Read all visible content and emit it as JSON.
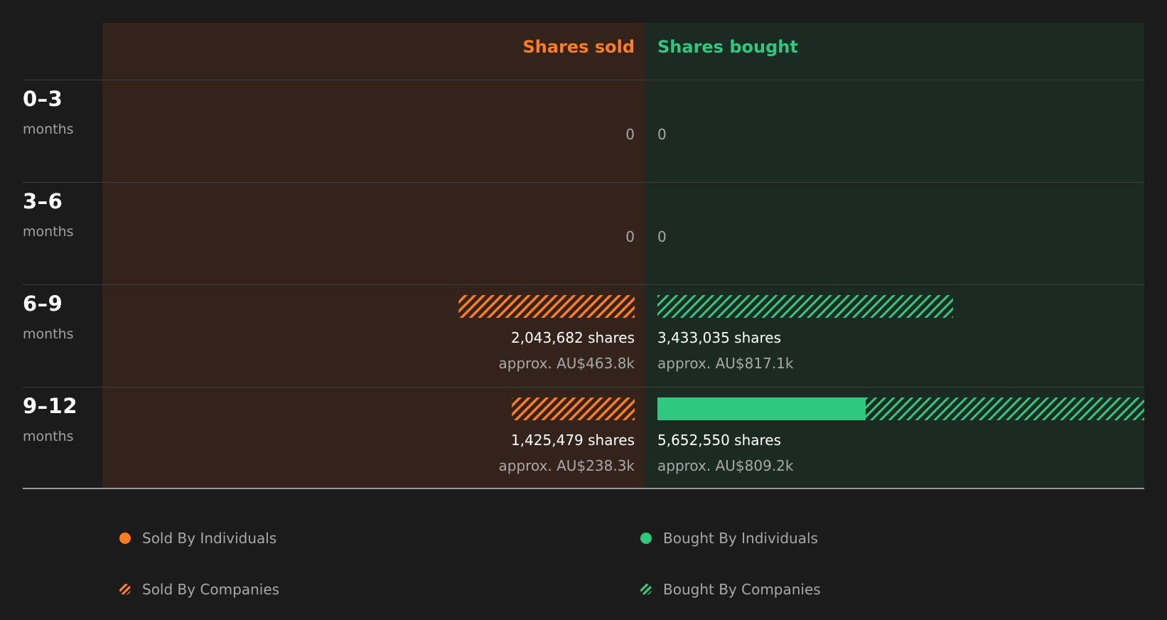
{
  "chart_data": {
    "type": "bar",
    "title": "",
    "column_headers": {
      "sold": "Shares sold",
      "bought": "Shares bought"
    },
    "colors": {
      "sold": "#ff7d1f",
      "bought": "#2ec97f",
      "sold_bg": "#33231b",
      "bought_bg": "#1c2a24"
    },
    "rows": [
      {
        "period": "0–3",
        "unit": "months",
        "sold": {
          "shares_label": "0",
          "approx_label": "",
          "individuals": 0,
          "companies": 0
        },
        "bought": {
          "shares_label": "0",
          "approx_label": "",
          "individuals": 0,
          "companies": 0
        }
      },
      {
        "period": "3–6",
        "unit": "months",
        "sold": {
          "shares_label": "0",
          "approx_label": "",
          "individuals": 0,
          "companies": 0
        },
        "bought": {
          "shares_label": "0",
          "approx_label": "",
          "individuals": 0,
          "companies": 0
        }
      },
      {
        "period": "6–9",
        "unit": "months",
        "sold": {
          "shares_label": "2,043,682 shares",
          "approx_label": "approx. AU$463.8k",
          "individuals": 0,
          "companies": 2043682
        },
        "bought": {
          "shares_label": "3,433,035 shares",
          "approx_label": "approx. AU$817.1k",
          "individuals": 0,
          "companies": 3433035
        }
      },
      {
        "period": "9–12",
        "unit": "months",
        "sold": {
          "shares_label": "1,425,479 shares",
          "approx_label": "approx. AU$238.3k",
          "individuals": 0,
          "companies": 1425479
        },
        "bought": {
          "shares_label": "5,652,550 shares",
          "approx_label": "approx. AU$809.2k",
          "individuals": 2418000,
          "companies": 3234550
        }
      }
    ],
    "scale_max": 5652550,
    "legend": [
      {
        "label": "Sold By Individuals",
        "side": "sold",
        "pattern": "solid"
      },
      {
        "label": "Bought By Individuals",
        "side": "bought",
        "pattern": "solid"
      },
      {
        "label": "Sold By Companies",
        "side": "sold",
        "pattern": "hatched"
      },
      {
        "label": "Bought By Companies",
        "side": "bought",
        "pattern": "hatched"
      }
    ]
  }
}
